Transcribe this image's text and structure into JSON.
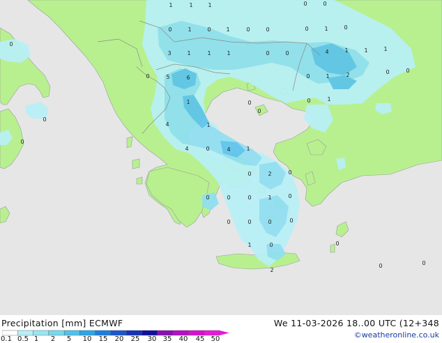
{
  "footer": {
    "title": "Precipitation [mm] ECMWF",
    "datetime": "We 11-03-2026 18..00 UTC (12+348",
    "credit": "©weatheronline.co.uk"
  },
  "legend": {
    "ticks": [
      "0.1",
      "0.5",
      "1",
      "2",
      "5",
      "10",
      "15",
      "20",
      "25",
      "30",
      "35",
      "40",
      "45",
      "50"
    ],
    "colors": [
      "#ffffff",
      "#b7f0f7",
      "#9ae6f2",
      "#78d8ee",
      "#4fc3ec",
      "#2aa7e6",
      "#1e7ede",
      "#1a56cf",
      "#1632b8",
      "#110e9e",
      "#8a10b4",
      "#b60ec6",
      "#d810cf",
      "#e81ad6"
    ]
  },
  "colors": {
    "sea": "#e6e6e6",
    "land": "#b8f090",
    "precip_light": "#b7f0f7",
    "precip_medium": "#8fdff2",
    "precip_heavy": "#5cc4ec",
    "border": "#8a8a8a"
  },
  "map_labels": [
    {
      "t": "1"
    },
    {
      "t": "1"
    },
    {
      "t": "1"
    },
    {
      "t": "0"
    },
    {
      "t": "0"
    },
    {
      "t": "0"
    },
    {
      "t": "1"
    },
    {
      "t": "0"
    },
    {
      "t": "1"
    },
    {
      "t": "0"
    },
    {
      "t": "0"
    },
    {
      "t": "0"
    },
    {
      "t": "1"
    },
    {
      "t": "0"
    },
    {
      "t": "0"
    },
    {
      "t": "3"
    },
    {
      "t": "1"
    },
    {
      "t": "1"
    },
    {
      "t": "1"
    },
    {
      "t": "0"
    },
    {
      "t": "0"
    },
    {
      "t": "4"
    },
    {
      "t": "1"
    },
    {
      "t": "1"
    },
    {
      "t": "1"
    },
    {
      "t": "0"
    },
    {
      "t": "5"
    },
    {
      "t": "6"
    },
    {
      "t": "0"
    },
    {
      "t": "1"
    },
    {
      "t": "2"
    },
    {
      "t": "0"
    },
    {
      "t": "0"
    },
    {
      "t": "1"
    },
    {
      "t": "0"
    },
    {
      "t": "0"
    },
    {
      "t": "1"
    },
    {
      "t": "0"
    },
    {
      "t": "0"
    },
    {
      "t": "4"
    },
    {
      "t": "1"
    },
    {
      "t": "4"
    },
    {
      "t": "0"
    },
    {
      "t": "4"
    },
    {
      "t": "1"
    },
    {
      "t": "0"
    },
    {
      "t": "0"
    },
    {
      "t": "2"
    },
    {
      "t": "0"
    },
    {
      "t": "0"
    },
    {
      "t": "0"
    },
    {
      "t": "0"
    },
    {
      "t": "1"
    },
    {
      "t": "0"
    },
    {
      "t": "0"
    },
    {
      "t": "0"
    },
    {
      "t": "0"
    },
    {
      "t": "0"
    },
    {
      "t": "0"
    },
    {
      "t": "1"
    },
    {
      "t": "0"
    },
    {
      "t": "0"
    },
    {
      "t": "0"
    },
    {
      "t": "2"
    }
  ]
}
